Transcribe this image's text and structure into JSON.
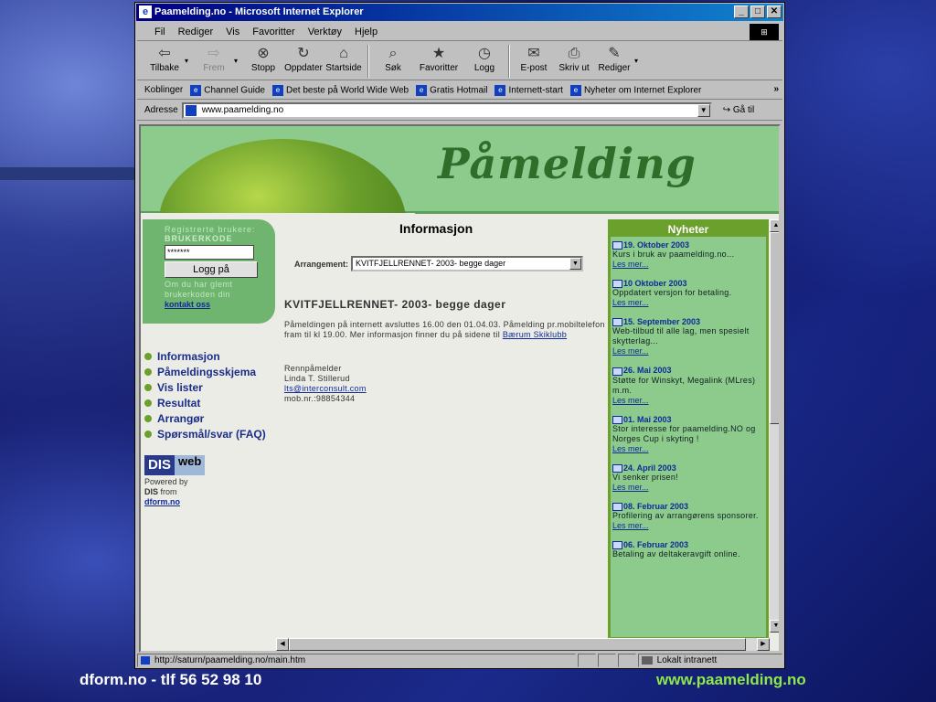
{
  "window": {
    "title": "Paamelding.no - Microsoft Internet Explorer"
  },
  "menu": [
    "Fil",
    "Rediger",
    "Vis",
    "Favoritter",
    "Verktøy",
    "Hjelp"
  ],
  "toolbar": [
    {
      "label": "Tilbake",
      "icon": "back-arrow-icon",
      "glyph": "⇦"
    },
    {
      "label": "Frem",
      "icon": "forward-arrow-icon",
      "glyph": "⇨"
    },
    {
      "label": "Stopp",
      "icon": "stop-icon",
      "glyph": "⊗"
    },
    {
      "label": "Oppdater",
      "icon": "refresh-icon",
      "glyph": "↻"
    },
    {
      "label": "Startside",
      "icon": "home-icon",
      "glyph": "⌂"
    },
    {
      "label": "Søk",
      "icon": "search-icon",
      "glyph": "⌕"
    },
    {
      "label": "Favoritter",
      "icon": "favorites-icon",
      "glyph": "★"
    },
    {
      "label": "Logg",
      "icon": "history-icon",
      "glyph": "◷"
    },
    {
      "label": "E-post",
      "icon": "mail-icon",
      "glyph": "✉"
    },
    {
      "label": "Skriv ut",
      "icon": "print-icon",
      "glyph": "⎙"
    },
    {
      "label": "Rediger",
      "icon": "edit-icon",
      "glyph": "✎"
    }
  ],
  "links": {
    "label": "Koblinger",
    "items": [
      "Channel Guide",
      "Det beste på World Wide Web",
      "Gratis Hotmail",
      "Internett-start",
      "Nyheter om Internet Explorer"
    ]
  },
  "address": {
    "label": "Adresse",
    "value": "www.paamelding.no",
    "go_label": "Gå til"
  },
  "page": {
    "logo": "Påmelding",
    "login": {
      "title": "Registrerte brukere:",
      "field_label": "BRUKERKODE",
      "password_value": "*******",
      "button": "Logg på",
      "hint": "Om du har glemt brukerkoden din",
      "contact": "kontakt oss"
    },
    "nav": [
      "Informasjon",
      "Påmeldingsskjema",
      "Vis lister",
      "Resultat",
      "Arrangør",
      "Spørsmål/svar (FAQ)"
    ],
    "disweb": {
      "dis": "DIS",
      "web": "web",
      "powered": "Powered by",
      "dis_b": "DIS",
      "from": "from",
      "link": "dform.no"
    },
    "info_title": "Informasjon",
    "arr_label": "Arrangement:",
    "arr_selected": "KVITFJELLRENNET- 2003- begge dager",
    "event_title": "KVITFJELLRENNET- 2003- begge dager",
    "body": "Påmeldingen på internett avsluttes 16.00 den 01.04.03. Påmelding pr.mobiltelefon fram til kl 19.00. Mer informasjon finner du på sidene til",
    "body_link": "Bærum Skiklubb",
    "contact": {
      "role": "Rennpåmelder",
      "name": "Linda T. Stillerud",
      "email": "lts@interconsult.com",
      "mobile": "mob.nr.:98854344"
    }
  },
  "news": {
    "title": "Nyheter",
    "more": "Les mer...",
    "items": [
      {
        "date": "19. Oktober 2003",
        "text": "Kurs i bruk av paamelding.no..."
      },
      {
        "date": "10 Oktober 2003",
        "text": "Oppdatert versjon for betaling."
      },
      {
        "date": "15. September 2003",
        "text": "Web-tilbud til alle lag, men spesielt skytterlag..."
      },
      {
        "date": "26. Mai 2003",
        "text": "Støtte for Winskyt, Megalink (MLres) m.m."
      },
      {
        "date": "01. Mai 2003",
        "text": "Stor interesse for paamelding.NO og Norges Cup i skyting !"
      },
      {
        "date": "24. April 2003",
        "text": "Vi senker prisen!"
      },
      {
        "date": "08. Februar 2003",
        "text": "Profilering av arrangørens sponsorer."
      },
      {
        "date": "06. Februar 2003",
        "text": "Betaling av deltakeravgift online."
      }
    ]
  },
  "status": {
    "url": "http://saturn/paamelding.no/main.htm",
    "zone": "Lokalt intranett"
  },
  "footer": {
    "left": "dform.no - tlf  56 52 98 10",
    "right": "www.paamelding.no"
  }
}
